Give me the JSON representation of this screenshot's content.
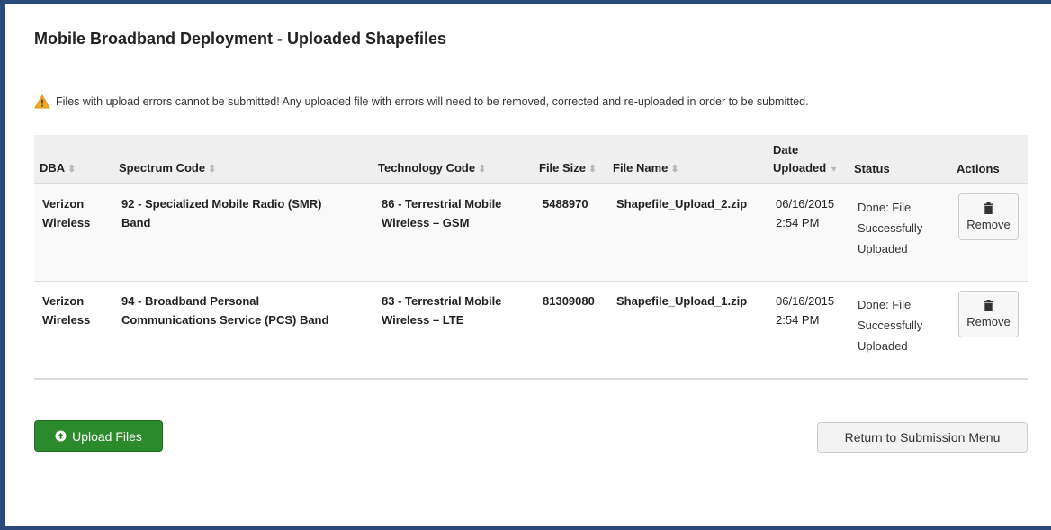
{
  "page": {
    "title": "Mobile Broadband Deployment - Uploaded Shapefiles",
    "warning": "Files with upload errors cannot be submitted! Any uploaded file with errors will need to be removed, corrected and re-uploaded in order to be submitted.",
    "warning_icon": "warning-triangle-icon",
    "warning_color": "#f0ad1e"
  },
  "table": {
    "columns": {
      "dba": "DBA",
      "spectrum": "Spectrum Code",
      "technology": "Technology Code",
      "filesize": "File Size",
      "filename": "File Name",
      "date_line1": "Date",
      "date_line2": "Uploaded",
      "status": "Status",
      "actions": "Actions"
    },
    "rows": [
      {
        "dba_1": "Verizon",
        "dba_2": "Wireless",
        "spectrum_1": "92 - Specialized Mobile Radio (SMR)",
        "spectrum_2": "Band",
        "tech_1": "86 - Terrestrial Mobile",
        "tech_2": "Wireless – GSM",
        "filesize": "5488970",
        "filename": "Shapefile_Upload_2.zip",
        "date": "06/16/2015",
        "time": "2:54 PM",
        "status_1": "Done: File",
        "status_2": "Successfully",
        "status_3": "Uploaded",
        "remove_label": "Remove"
      },
      {
        "dba_1": "Verizon",
        "dba_2": "Wireless",
        "spectrum_1": "94 - Broadband Personal",
        "spectrum_2": "Communications Service (PCS) Band",
        "tech_1": "83 - Terrestrial Mobile",
        "tech_2": "Wireless – LTE",
        "filesize": "81309080",
        "filename": "Shapefile_Upload_1.zip",
        "date": "06/16/2015",
        "time": "2:54 PM",
        "status_1": "Done: File",
        "status_2": "Successfully",
        "status_3": "Uploaded",
        "remove_label": "Remove"
      }
    ]
  },
  "buttons": {
    "upload": "Upload Files",
    "upload_icon": "upload-circle-icon",
    "return": "Return to Submission Menu"
  },
  "colors": {
    "frame": "#2a4a7c",
    "upload_button": "#2b8a2b",
    "header_bg": "#efefef"
  }
}
